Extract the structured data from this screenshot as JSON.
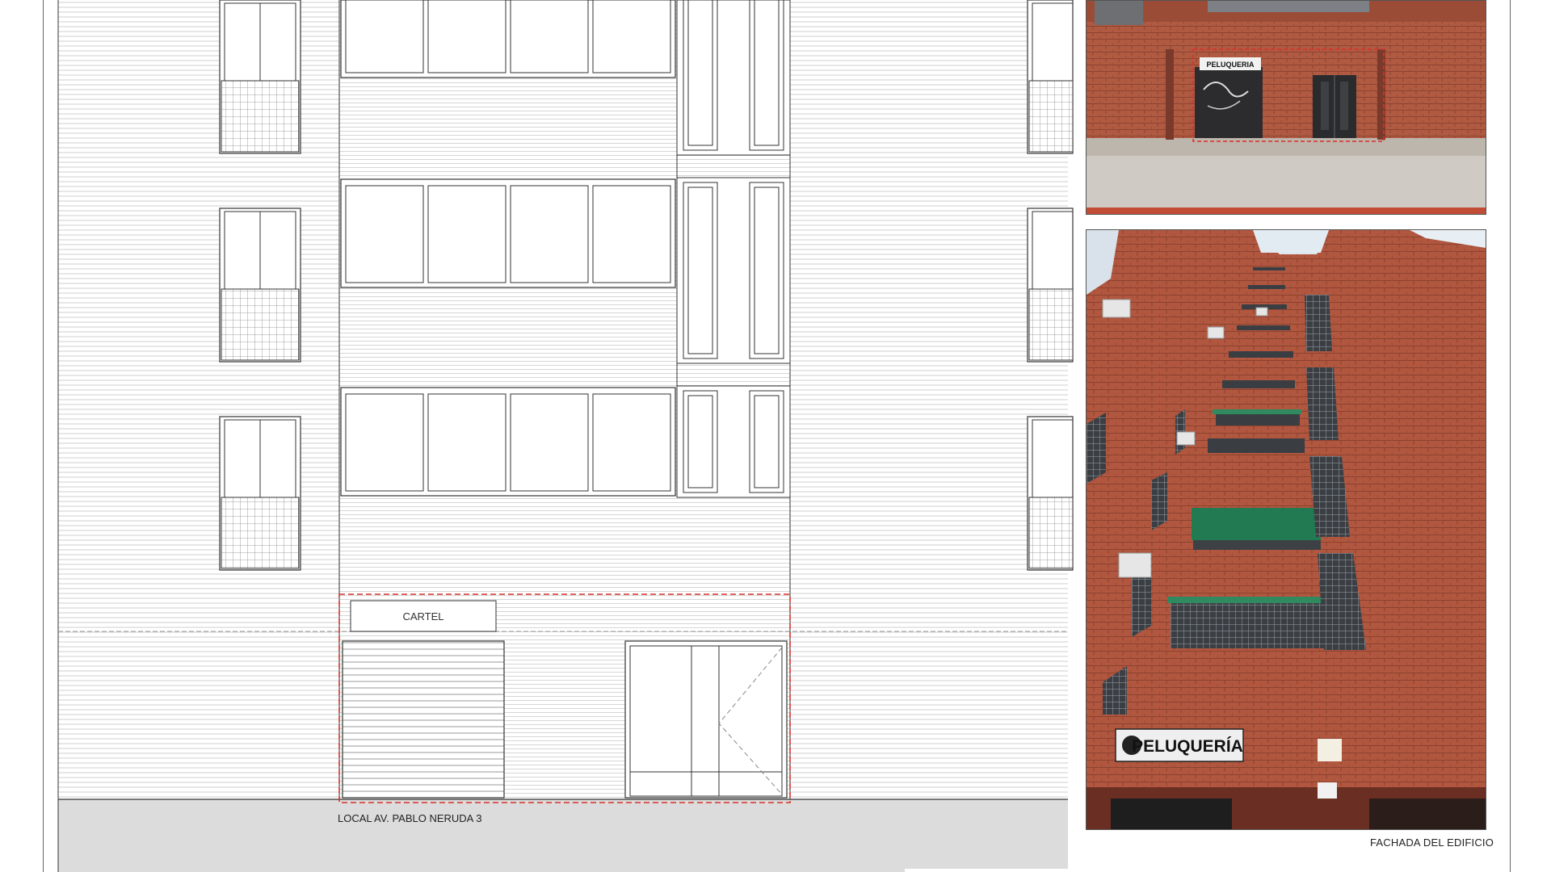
{
  "drawing": {
    "sign_label": "CARTEL",
    "site_label": "LOCAL AV. PABLO NERUDA 3"
  },
  "photos": {
    "caption": "FACHADA DEL EDIFICIO",
    "shop_sign_text": "PELUQUERIA",
    "shop_sign_text_large": "PELUQUERÍA"
  },
  "colors": {
    "highlight": "#d9312b",
    "brick": "#a8553f",
    "awning": "#1f7a55",
    "line": "#333333",
    "hatch": "#c8c8c8",
    "ground": "#dcdcdc"
  }
}
